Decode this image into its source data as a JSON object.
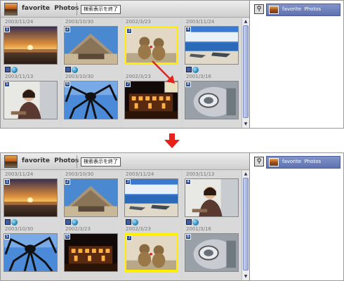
{
  "panels": [
    {
      "header": {
        "title": "favorite  Photos",
        "exit_search_button": "検索表示を終了"
      },
      "sidebar": {
        "item_label": "favorite  Photos"
      },
      "cells": [
        {
          "date": "2003/11/24",
          "num": "1",
          "scene": "sunset",
          "selected": false,
          "icons": true
        },
        {
          "date": "2003/10/30",
          "num": "2",
          "scene": "hut",
          "selected": false,
          "icons": true
        },
        {
          "date": "2002/3/23",
          "num": "3",
          "scene": "bears",
          "selected": true,
          "icons": false
        },
        {
          "date": "2003/11/24",
          "num": "4",
          "scene": "beach",
          "selected": false,
          "icons": true
        },
        {
          "date": "2003/11/13",
          "num": "5",
          "scene": "woman",
          "selected": false,
          "icons": false
        },
        {
          "date": "2003/10/30",
          "num": "6",
          "scene": "spider",
          "selected": false,
          "icons": false
        },
        {
          "date": "2002/3/23",
          "num": "7",
          "scene": "night",
          "selected": false,
          "icons": false
        },
        {
          "date": "2001/3/16",
          "num": "8",
          "scene": "scooter",
          "selected": false,
          "icons": false
        }
      ]
    },
    {
      "header": {
        "title": "favorite  Photos",
        "exit_search_button": "検索表示を終了"
      },
      "sidebar": {
        "item_label": "favorite  Photos"
      },
      "cells": [
        {
          "date": "2003/11/24",
          "num": "1",
          "scene": "sunset",
          "selected": false,
          "icons": true
        },
        {
          "date": "2003/10/30",
          "num": "2",
          "scene": "hut",
          "selected": false,
          "icons": true
        },
        {
          "date": "2003/11/24",
          "num": "3",
          "scene": "beach",
          "selected": false,
          "icons": true
        },
        {
          "date": "2003/11/13",
          "num": "4",
          "scene": "woman",
          "selected": false,
          "icons": true
        },
        {
          "date": "2003/10/30",
          "num": "5",
          "scene": "spider",
          "selected": false,
          "icons": false
        },
        {
          "date": "2002/3/23",
          "num": "6",
          "scene": "night",
          "selected": false,
          "icons": false
        },
        {
          "date": "2002/3/23",
          "num": "7",
          "scene": "bears",
          "selected": true,
          "icons": false
        },
        {
          "date": "2001/3/16",
          "num": "8",
          "scene": "scooter",
          "selected": false,
          "icons": false
        }
      ]
    }
  ],
  "icons": {
    "header": "photo-album-icon",
    "sidebar": "binoculars-icon",
    "transition": "down-arrow-icon",
    "drag": "drag-arrow-icon"
  },
  "colors": {
    "arrow": "#e8201a",
    "selection": "#ffee00",
    "sidebar_selected": "#6f82bd"
  }
}
